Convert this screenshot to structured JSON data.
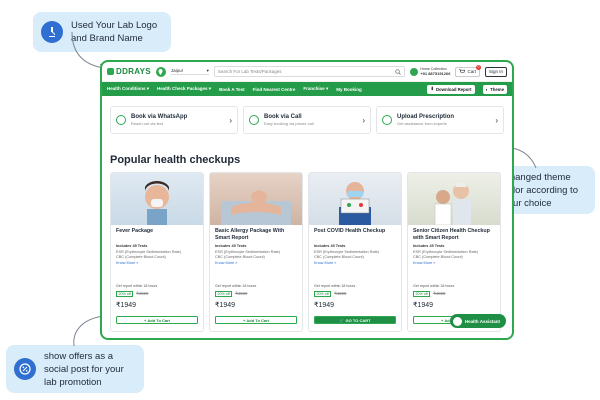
{
  "callouts": {
    "logo": "Used Your Lab Logo and Brand Name",
    "theme": "Changed theme color according to your choice",
    "offer": "show offers as a social post for your lab promotion"
  },
  "colors": {
    "accent": "#2ea84f",
    "nav_bg": "#249c49",
    "callout_bg": "#d9ecfa",
    "callout_icon_bg": "#2f6fd1"
  },
  "header": {
    "brand": "DDRAYS",
    "location": "Jaipur",
    "search_placeholder": "Search For Lab Tests/Packages",
    "phone_label": "Home Collection",
    "phone_number": "+91 8875151266",
    "cart_label": "Cart",
    "cart_count": "0",
    "signin_label": "Sign In"
  },
  "nav": {
    "items": [
      "Health Conditions",
      "Health Check Packages",
      "Book A Test",
      "Find Nearest Centre",
      "Franchise",
      "My Booking"
    ],
    "download_report": "Download Report",
    "theme": "Theme"
  },
  "options": [
    {
      "title": "Book via WhatsApp",
      "subtitle": "Reach out via text",
      "icon": "whatsapp-icon"
    },
    {
      "title": "Book via Call",
      "subtitle": "Easy booking via phone call",
      "icon": "phone-icon"
    },
    {
      "title": "Upload Prescription",
      "subtitle": "Get assistance from experts",
      "icon": "prescription-icon"
    }
  ],
  "section_title": "Popular health checkups",
  "cards": [
    {
      "title": "Fever Package",
      "includes": "Includes 45 Tests",
      "test1": "ESR (Erythrocyte Sedimentation Rate)",
      "test2": "CBC (Complete Blood Count)",
      "know_more": "Know More »",
      "report": "Get report within 18 hours",
      "off": "20% off",
      "mrp": "₹4599",
      "price": "₹1949",
      "cta": "Add To Cart"
    },
    {
      "title": "Basic Allergy Package With Smart Report",
      "includes": "Includes 45 Tests",
      "test1": "ESR (Erythrocyte Sedimentation Rate)",
      "test2": "CBC (Complete Blood Count)",
      "know_more": "Know More »",
      "report": "Get report within 18 hours",
      "off": "20% off",
      "mrp": "₹4599",
      "price": "₹1949",
      "cta": "Add To Cart"
    },
    {
      "title": "Post COVID Health Checkup",
      "includes": "Includes 45 Tests",
      "test1": "ESR (Erythrocyte Sedimentation Rate)",
      "test2": "CBC (Complete Blood Count)",
      "know_more": "Know More »",
      "report": "Get report within 18 hours",
      "off": "20% off",
      "mrp": "₹4599",
      "price": "₹1949",
      "cta": "GO TO CART"
    },
    {
      "title": "Senior Citizen Health Checkup with Smart Report",
      "includes": "Includes 45 Tests",
      "test1": "ESR (Erythrocyte Sedimentation Rate)",
      "test2": "CBC (Complete Blood Count)",
      "know_more": "Know More »",
      "report": "Get report within 18 hours",
      "off": "20% off",
      "mrp": "₹4599",
      "price": "₹1949",
      "cta": "Add To Cart"
    }
  ],
  "assistant": "Health Assistant"
}
